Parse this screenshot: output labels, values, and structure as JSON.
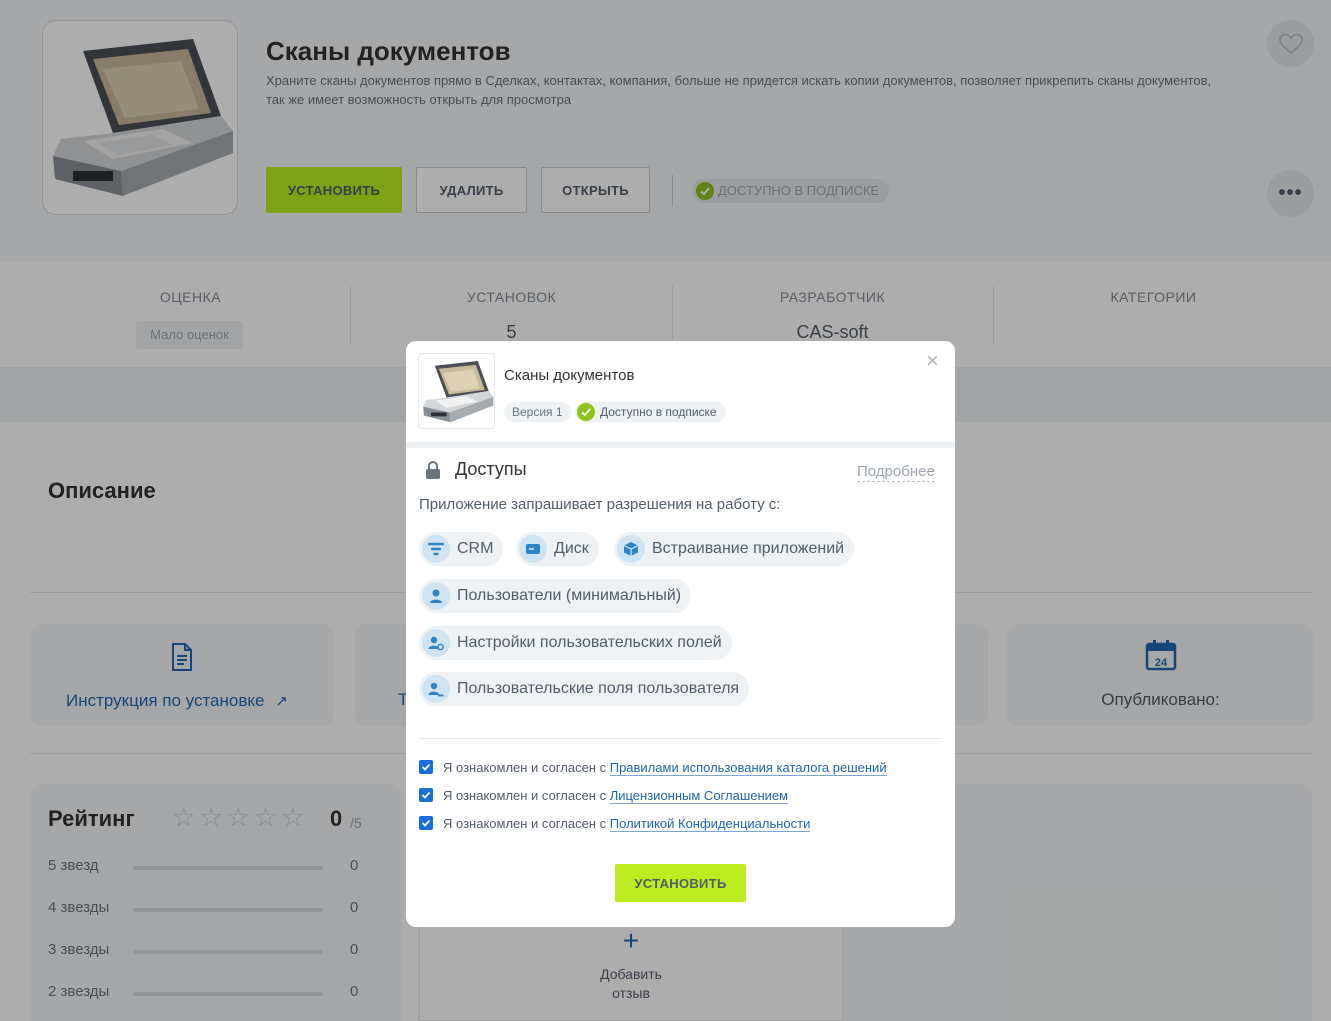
{
  "app": {
    "title": "Сканы документов",
    "description": "Храните сканы документов прямо в Сделках, контактах, компания, больше не придется искать копии документов, позволяет прикрепить сканы документов, так же имеет возможность открыть для просмотра",
    "install_label": "УСТАНОВИТЬ",
    "delete_label": "УДАЛИТЬ",
    "open_label": "ОТКРЫТЬ",
    "subscription_label": "ДОСТУПНО В ПОДПИСКЕ",
    "more_label": "•••"
  },
  "stats": {
    "rating_label": "ОЦЕНКА",
    "rating_value": "Мало оценок",
    "installs_label": "УСТАНОВОК",
    "installs_value": "5",
    "developer_label": "РАЗРАБОТЧИК",
    "developer_value": "CAS-soft",
    "categories_label": "КАТЕГОРИИ"
  },
  "description_section": {
    "title": "Описание"
  },
  "info_cards": {
    "instruction_label": "Инструкция по установке",
    "instruction_arrow": "↗",
    "partial_label": "T",
    "published_label": "Опубликовано:",
    "calendar_day": "24"
  },
  "rating": {
    "title": "Рейтинг",
    "score": "0",
    "max": "/5",
    "rows": [
      {
        "label": "5 звезд",
        "count": "0"
      },
      {
        "label": "4 звезды",
        "count": "0"
      },
      {
        "label": "3 звезды",
        "count": "0"
      },
      {
        "label": "2 звезды",
        "count": "0"
      }
    ]
  },
  "review": {
    "plus": "+",
    "add_line1": "Добавить",
    "add_line2": "отзыв"
  },
  "modal": {
    "title": "Сканы документов",
    "version": "Версия 1",
    "subscription": "Доступно в подписке",
    "close": "×",
    "access_title": "Доступы",
    "more_link": "Подробнее",
    "request_text": "Приложение запрашивает разрешения на работу с:",
    "permissions": [
      {
        "label": "CRM",
        "icon": "crm-filter-icon"
      },
      {
        "label": "Диск",
        "icon": "disk-icon"
      },
      {
        "label": "Встраивание приложений",
        "icon": "embed-cube-icon"
      },
      {
        "label": "Пользователи (минимальный)",
        "icon": "user-icon"
      },
      {
        "label": "Настройки пользовательских полей",
        "icon": "user-settings-icon"
      },
      {
        "label": "Пользовательские поля пользователя",
        "icon": "user-fields-icon"
      }
    ],
    "agreements": [
      {
        "prefix": "Я ознакомлен и согласен с ",
        "link": "Правилами использования каталога решений",
        "checked": true
      },
      {
        "prefix": "Я ознакомлен и согласен с ",
        "link": "Лицензионным Соглашением",
        "checked": true
      },
      {
        "prefix": "Я ознакомлен и согласен с ",
        "link": "Политикой Конфиденциальности",
        "checked": true
      }
    ],
    "install_label": "УСТАНОВИТЬ"
  },
  "colors": {
    "accent_green": "#bbed21",
    "link_blue": "#2067b0",
    "check_green": "#8ec21b"
  }
}
